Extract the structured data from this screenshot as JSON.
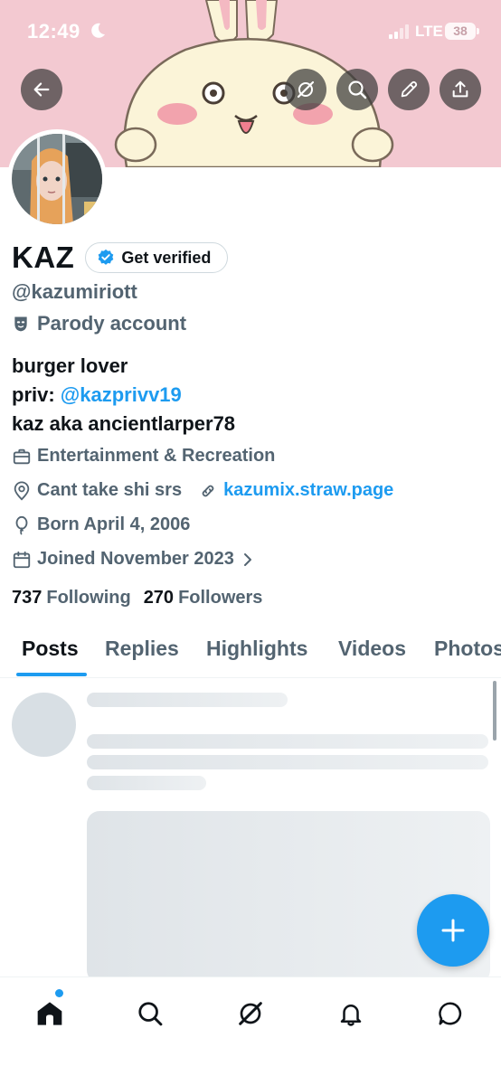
{
  "status_bar": {
    "time": "12:49",
    "network": "LTE",
    "battery": "38"
  },
  "profile": {
    "display_name": "KAZ",
    "verify_label": "Get verified",
    "handle": "@kazumiriott",
    "parody_label": "Parody account",
    "bio": {
      "line1": "burger lover",
      "line2_prefix": "priv: ",
      "line2_link": "@kazprivv19",
      "line3": "kaz aka ancientlarper78"
    },
    "category": "Entertainment & Recreation",
    "location": "Cant take shi srs",
    "website": "kazumix.straw.page",
    "birthday": "Born April 4, 2006",
    "joined": "Joined November 2023",
    "following_count": "737",
    "following_label": "Following",
    "followers_count": "270",
    "followers_label": "Followers"
  },
  "tabs": [
    {
      "label": "Posts",
      "active": true
    },
    {
      "label": "Replies"
    },
    {
      "label": "Highlights"
    },
    {
      "label": "Videos"
    },
    {
      "label": "Photos"
    }
  ],
  "colors": {
    "accent": "#1d9bf0",
    "banner": "#f2c7d0",
    "text_primary": "#0f1419",
    "text_secondary": "#536471"
  },
  "icons": {
    "header": [
      "back-arrow-icon",
      "grok-icon",
      "search-icon",
      "edit-icon",
      "share-icon"
    ],
    "nav": [
      "home-icon",
      "search-icon",
      "grok-icon",
      "bell-icon",
      "messages-icon"
    ],
    "fab": "plus-icon"
  }
}
